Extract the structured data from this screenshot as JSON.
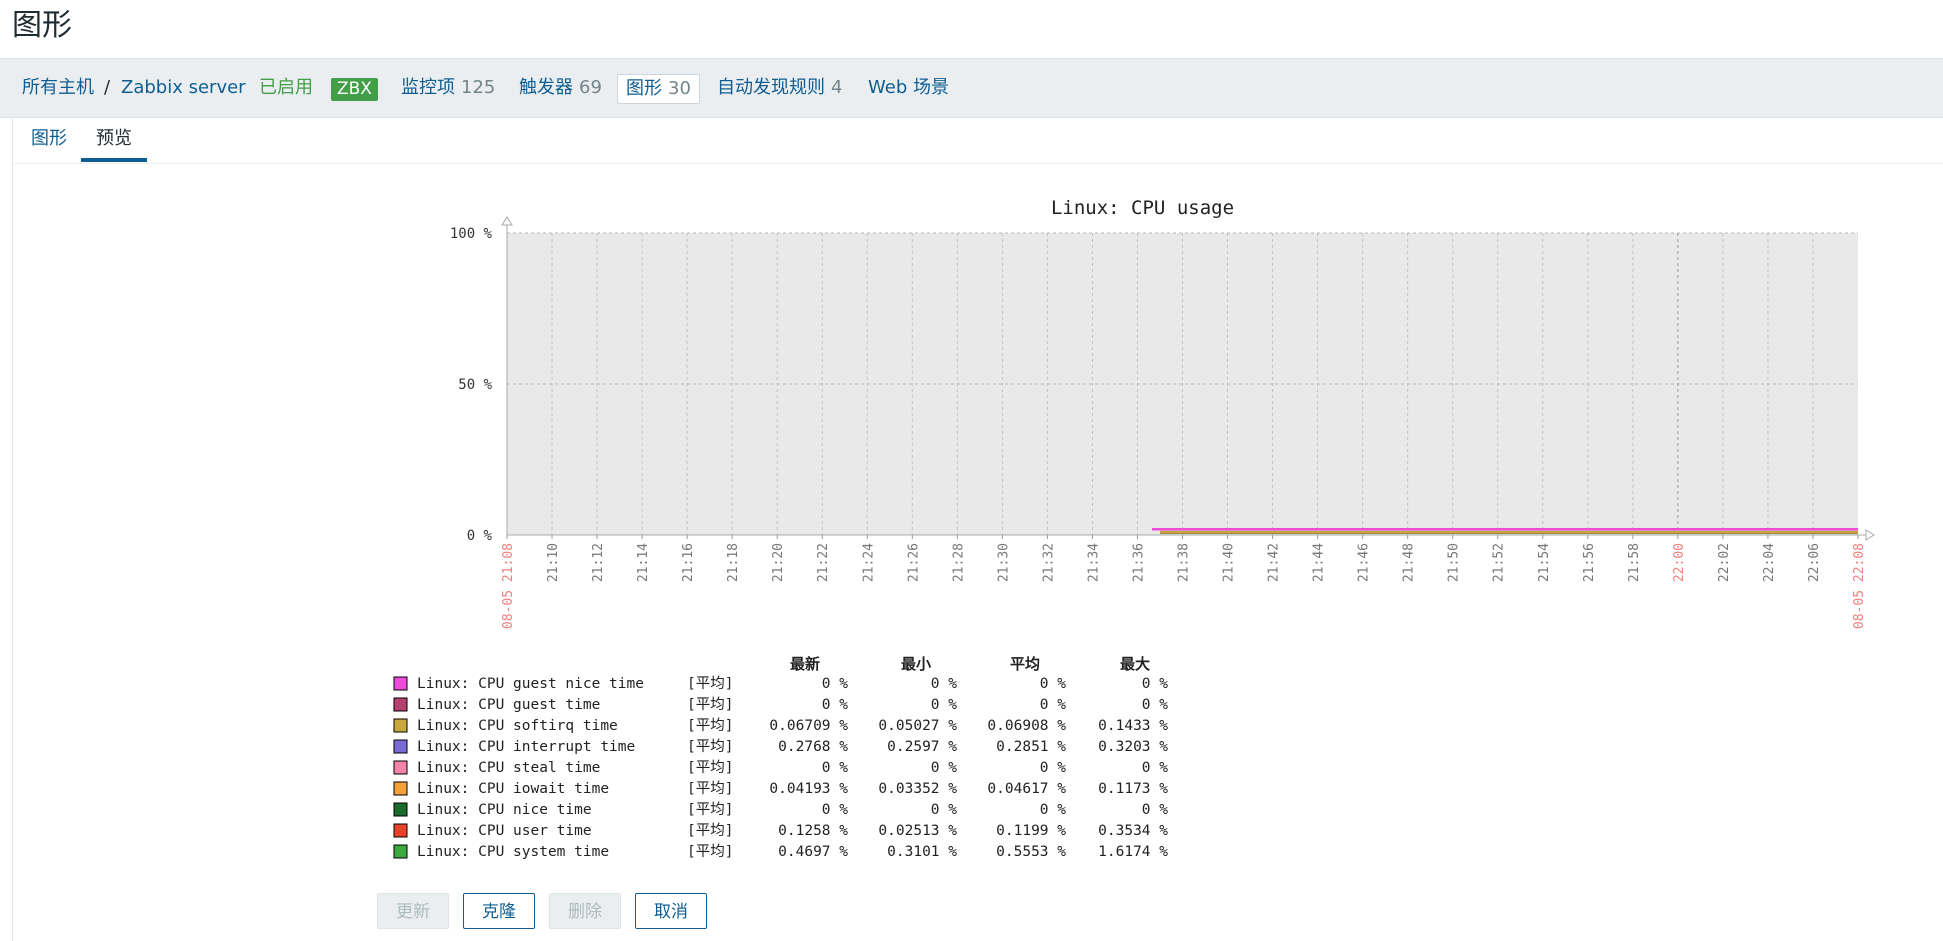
{
  "page": {
    "title": "图形"
  },
  "breadcrumb": {
    "all_hosts": "所有主机",
    "separator": "/",
    "host": "Zabbix server",
    "status": "已启用",
    "zbx_badge": "ZBX"
  },
  "host_nav": [
    {
      "label": "监控项",
      "count": "125"
    },
    {
      "label": "触发器",
      "count": "69"
    },
    {
      "label": "图形",
      "count": "30"
    },
    {
      "label": "自动发现规则",
      "count": "4"
    },
    {
      "label": "Web 场景",
      "count": ""
    }
  ],
  "tabs": [
    {
      "label": "图形",
      "active": false
    },
    {
      "label": "预览",
      "active": true
    }
  ],
  "buttons": {
    "update": "更新",
    "clone": "克隆",
    "delete": "删除",
    "cancel": "取消"
  },
  "colors": {
    "link": "#0f5e93",
    "enabled": "#429e47",
    "plot_bg": "#e9e9e9",
    "red_time": "#f08080"
  },
  "chart_data": {
    "type": "area",
    "title": "Linux:  CPU usage",
    "y_ticks": [
      "100 %",
      "50 %",
      "0 %"
    ],
    "ylim": [
      0,
      100
    ],
    "y_unit": "%",
    "x_ticks": [
      "08-05 21:08",
      "21:10",
      "21:12",
      "21:14",
      "21:16",
      "21:18",
      "21:20",
      "21:22",
      "21:24",
      "21:26",
      "21:28",
      "21:30",
      "21:32",
      "21:34",
      "21:36",
      "21:38",
      "21:40",
      "21:42",
      "21:44",
      "21:46",
      "21:48",
      "21:50",
      "21:52",
      "21:54",
      "21:56",
      "21:58",
      "22:00",
      "22:02",
      "22:04",
      "22:06",
      "08-05 22:08"
    ],
    "x_ticks_red": [
      "08-05 21:08",
      "22:00",
      "08-05 22:08"
    ],
    "grid": true,
    "data_start": "21:37",
    "legend_headers": [
      "最新",
      "最小",
      "平均",
      "最大"
    ],
    "series": [
      {
        "name": "Linux:  CPU guest nice time",
        "func": "[平均]",
        "color": "#ec4cd9",
        "last": "0 %",
        "min": "0 %",
        "avg": "0 %",
        "max": "0 %"
      },
      {
        "name": "Linux:  CPU guest time",
        "func": "[平均]",
        "color": "#b6416e",
        "last": "0 %",
        "min": "0 %",
        "avg": "0 %",
        "max": "0 %"
      },
      {
        "name": "Linux:  CPU softirq time",
        "func": "[平均]",
        "color": "#c9a93f",
        "last": "0.06709 %",
        "min": "0.05027 %",
        "avg": "0.06908 %",
        "max": "0.1433 %"
      },
      {
        "name": "Linux:  CPU interrupt time",
        "func": "[平均]",
        "color": "#7a6bd6",
        "last": "0.2768 %",
        "min": "0.2597 %",
        "avg": "0.2851 %",
        "max": "0.3203 %"
      },
      {
        "name": "Linux:  CPU steal time",
        "func": "[平均]",
        "color": "#f384a8",
        "last": "0 %",
        "min": "0 %",
        "avg": "0 %",
        "max": "0 %"
      },
      {
        "name": "Linux:  CPU iowait time",
        "func": "[平均]",
        "color": "#f5a03a",
        "last": "0.04193 %",
        "min": "0.03352 %",
        "avg": "0.04617 %",
        "max": "0.1173 %"
      },
      {
        "name": "Linux:  CPU nice time",
        "func": "[平均]",
        "color": "#1a6b2c",
        "last": "0 %",
        "min": "0 %",
        "avg": "0 %",
        "max": "0 %"
      },
      {
        "name": "Linux:  CPU user time",
        "func": "[平均]",
        "color": "#e8432a",
        "last": "0.1258 %",
        "min": "0.02513 %",
        "avg": "0.1199 %",
        "max": "0.3534 %"
      },
      {
        "name": "Linux:  CPU system time",
        "func": "[平均]",
        "color": "#3caa3c",
        "last": "0.4697 %",
        "min": "0.3101 %",
        "avg": "0.5553 %",
        "max": "1.6174 %"
      }
    ]
  }
}
